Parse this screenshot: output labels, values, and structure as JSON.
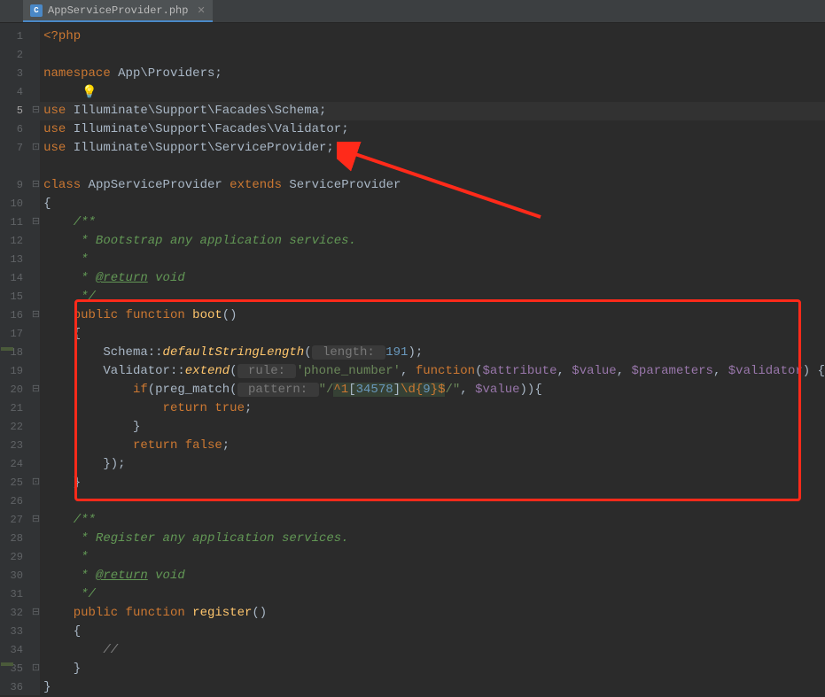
{
  "tab": {
    "filename": "AppServiceProvider.php",
    "icon_letter": "C"
  },
  "gutter": {
    "lines": [
      "1",
      "2",
      "3",
      "4",
      "5",
      "6",
      "7",
      "",
      "9",
      "10",
      "11",
      "12",
      "13",
      "14",
      "15",
      "16",
      "17",
      "18",
      "19",
      "20",
      "21",
      "22",
      "23",
      "24",
      "25",
      "26",
      "27",
      "28",
      "29",
      "30",
      "31",
      "32",
      "33",
      "34",
      "35",
      "36"
    ]
  },
  "folds": [
    "",
    "",
    "",
    "",
    "⊟",
    "",
    "⊡",
    "",
    "⊟",
    "",
    "⊟",
    "",
    "",
    "",
    "",
    "⊟",
    "",
    "",
    "",
    "⊟",
    "",
    "",
    "",
    "",
    "⊡",
    "",
    "⊟",
    "",
    "",
    "",
    "",
    "⊟",
    "",
    "",
    "⊡",
    ""
  ],
  "code": {
    "l1_open": "<?php",
    "l3_ns": "namespace",
    "l3_path": " App\\Providers;",
    "l5_use": "use",
    "l5_path": " Illuminate\\Support\\Facades\\Schema;",
    "l6_use": "use",
    "l6_path": " Illuminate\\Support\\Facades\\Validator;",
    "l7_use": "use",
    "l7_path": " Illuminate\\Support\\ServiceProvider;",
    "l9_class": "class",
    "l9_name": " AppServiceProvider ",
    "l9_ext": "extends",
    "l9_parent": " ServiceProvider",
    "l10": "{",
    "l11": "    /**",
    "l12": "     * Bootstrap any application services.",
    "l13": "     *",
    "l14_pre": "     * ",
    "l14_tag": "@return",
    "l14_post": " void",
    "l15": "     */",
    "l16_pub": "    public",
    "l16_fun": " function",
    "l16_name": " boot",
    "l16_par": "()",
    "l17": "    {",
    "l18_a": "        Schema::",
    "l18_b": "defaultStringLength",
    "l18_c": "(",
    "l18_hint": " length: ",
    "l18_num": "191",
    "l18_d": ");",
    "l19_a": "        Validator::",
    "l19_b": "extend",
    "l19_c": "(",
    "l19_hint": " rule: ",
    "l19_str": "'phone_number'",
    "l19_d": ", ",
    "l19_fun": "function",
    "l19_e": "(",
    "l19_v1": "$attribute",
    "l19_v2": "$value",
    "l19_v3": "$parameters",
    "l19_v4": "$validator",
    "l19_f": ") {",
    "l20_a": "            if",
    "l20_b": "(preg_match(",
    "l20_hint": " pattern: ",
    "l20_r1": "\"/",
    "l20_r2": "^1",
    "l20_r3": "[",
    "l20_r4": "34578",
    "l20_r5": "]",
    "l20_r6": "\\d{",
    "l20_r7": "9",
    "l20_r8": "}",
    "l20_r9": "$",
    "l20_r10": "/\"",
    "l20_c": ", ",
    "l20_v": "$value",
    "l20_d": ")){",
    "l21_a": "                return",
    "l21_b": " true",
    "l21_c": ";",
    "l22": "            }",
    "l23_a": "            return",
    "l23_b": " false",
    "l23_c": ";",
    "l24": "        });",
    "l25": "    }",
    "l27": "    /**",
    "l28": "     * Register any application services.",
    "l29": "     *",
    "l30_pre": "     * ",
    "l30_tag": "@return",
    "l30_post": " void",
    "l31": "     */",
    "l32_pub": "    public",
    "l32_fun": " function",
    "l32_name": " register",
    "l32_par": "()",
    "l33": "    {",
    "l34": "        //",
    "l35": "    }",
    "l36": "}"
  },
  "annotations": {
    "arrow_target": "use ServiceProvider line",
    "highlight_box": "boot() function"
  }
}
